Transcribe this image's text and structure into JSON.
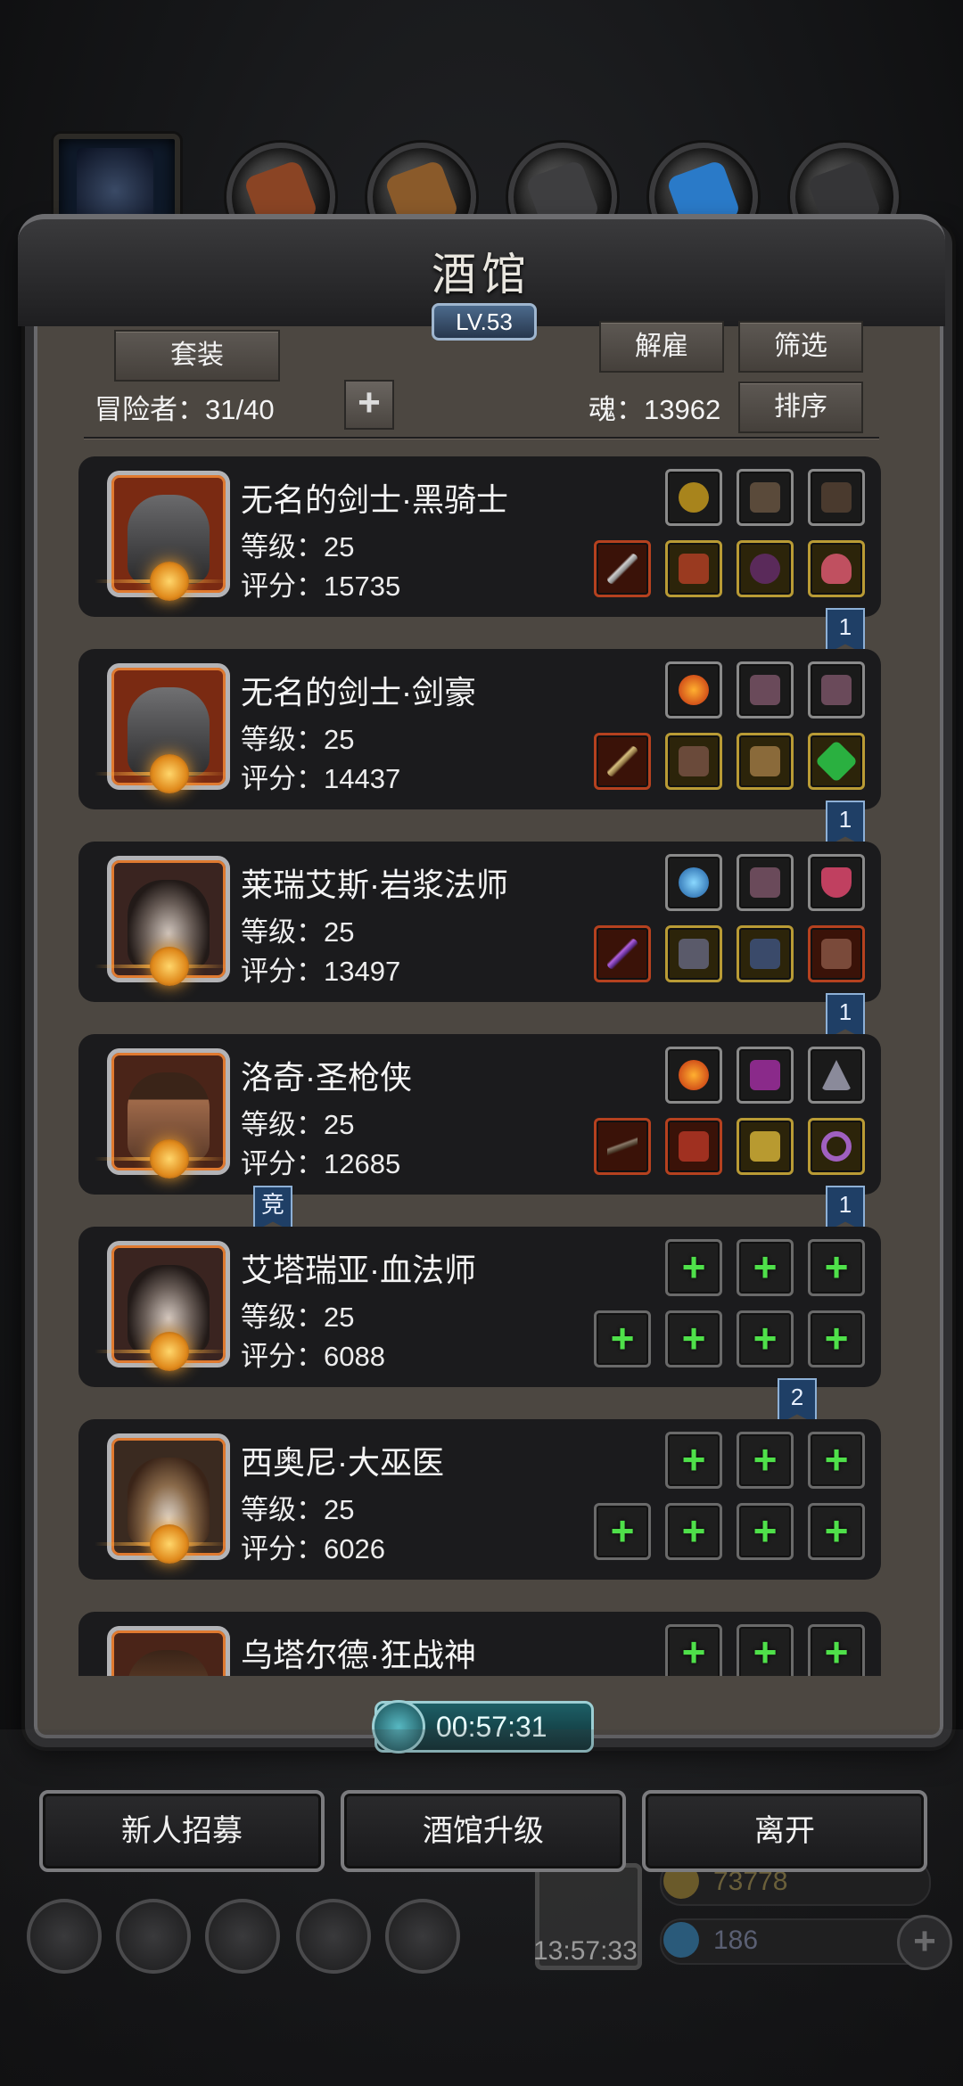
{
  "window": {
    "title": "酒馆",
    "level": "LV.53"
  },
  "toolbar": {
    "set_label": "套装",
    "dismiss_label": "解雇",
    "filter_label": "筛选",
    "sort_label": "排序",
    "adventurers_label": "冒险者：31/40",
    "soul_label": "魂：13962",
    "add_label": "+"
  },
  "heroes": [
    {
      "name": "无名的剑士·黑骑士",
      "level": "等级：25",
      "score": "评分：15735",
      "badge": "1"
    },
    {
      "name": "无名的剑士·剑豪",
      "level": "等级：25",
      "score": "评分：14437",
      "badge": "1"
    },
    {
      "name": "莱瑞艾斯·岩浆法师",
      "level": "等级：25",
      "score": "评分：13497",
      "badge": "1"
    },
    {
      "name": "洛奇·圣枪侠",
      "level": "等级：25",
      "score": "评分：12685",
      "badge": "1",
      "tag": "竞"
    },
    {
      "name": "艾塔瑞亚·血法师",
      "level": "等级：25",
      "score": "评分：6088",
      "badge": "2"
    },
    {
      "name": "西奥尼·大巫医",
      "level": "等级：25",
      "score": "评分：6026"
    },
    {
      "name": "乌塔尔德·狂战神"
    }
  ],
  "timer": "00:57:31",
  "bottom_buttons": {
    "recruit": "新人招募",
    "upgrade": "酒馆升级",
    "leave": "离开"
  },
  "hud": {
    "gold": "73778",
    "gems": "186",
    "chest_timer": "13:57:33",
    "add": "+"
  },
  "colors": {
    "accent_green": "#4fe04a",
    "frame": "#4c4741",
    "ribbon": "#1f3f66"
  }
}
